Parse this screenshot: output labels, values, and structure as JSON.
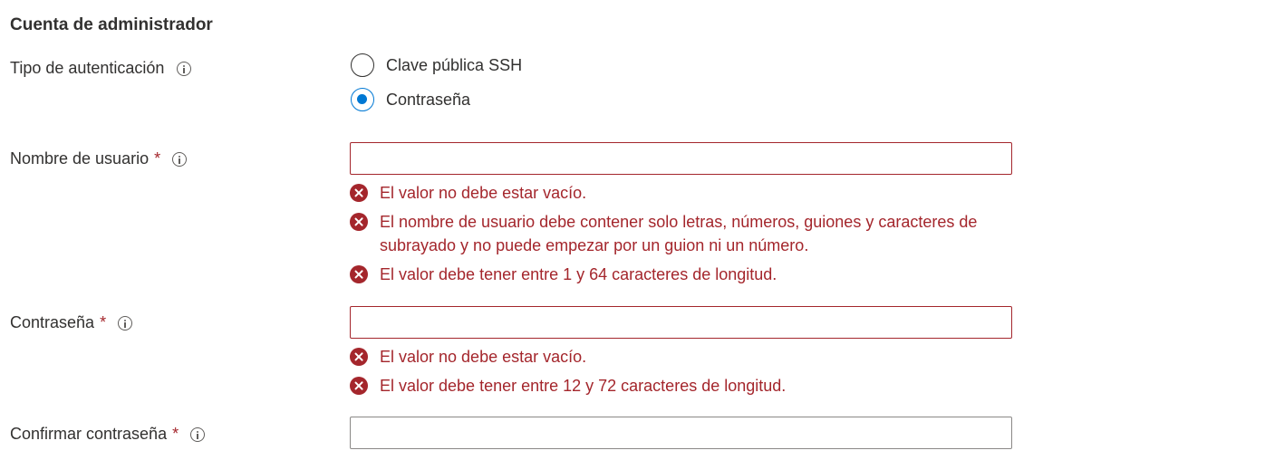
{
  "section": {
    "title": "Cuenta de administrador"
  },
  "auth_type": {
    "label": "Tipo de autenticación",
    "options": [
      {
        "label": "Clave pública SSH",
        "selected": false
      },
      {
        "label": "Contraseña",
        "selected": true
      }
    ]
  },
  "username": {
    "label": "Nombre de usuario",
    "required_mark": "*",
    "value": "",
    "errors": [
      "El valor no debe estar vacío.",
      "El nombre de usuario debe contener solo letras, números, guiones y caracteres de subrayado y no puede empezar por un guion ni un número.",
      "El valor debe tener entre 1 y 64 caracteres de longitud."
    ]
  },
  "password": {
    "label": "Contraseña",
    "required_mark": "*",
    "value": "",
    "errors": [
      "El valor no debe estar vacío.",
      "El valor debe tener entre 12 y 72 caracteres de longitud."
    ]
  },
  "confirm_password": {
    "label": "Confirmar contraseña",
    "required_mark": "*",
    "value": ""
  },
  "colors": {
    "accent": "#0078d4",
    "error": "#a4262c",
    "text": "#323130"
  },
  "icons": {
    "info": "info-icon",
    "error": "error-circle-icon"
  }
}
